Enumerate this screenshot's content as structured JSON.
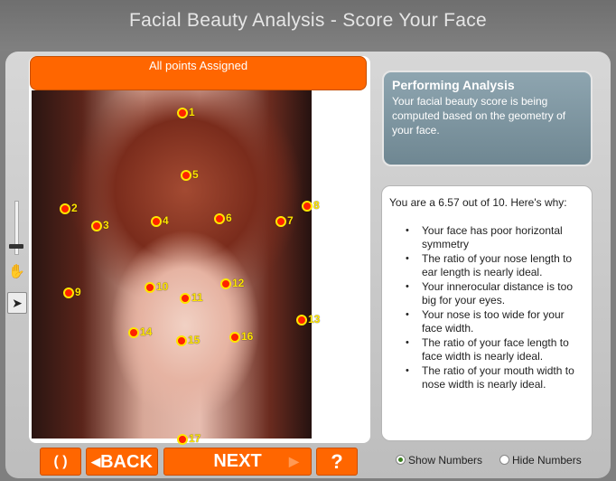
{
  "app": {
    "title": "Facial Beauty Analysis - Score Your Face"
  },
  "status": {
    "message": "All points Assigned"
  },
  "analysis": {
    "title": "Performing Analysis",
    "text": "Your facial beauty score is being computed based on the geometry of your face."
  },
  "results": {
    "summary": "You are a 6.57 out of 10.  Here's why:",
    "items": [
      "Your face has poor horizontal symmetry",
      "The ratio of your nose length to ear length is nearly ideal.",
      "Your innerocular distance is too big for your eyes.",
      "Your nose is too wide for your face width.",
      "The ratio of your face length to face width is nearly ideal.",
      "The ratio of your mouth width to nose width is nearly ideal."
    ]
  },
  "markers": [
    "1",
    "2",
    "3",
    "4",
    "5",
    "6",
    "7",
    "8",
    "9",
    "10",
    "11",
    "12",
    "13",
    "14",
    "15",
    "16",
    "17"
  ],
  "buttons": {
    "reset_symbol": "( )",
    "back_label": "BACK",
    "back_arrow": "◀",
    "next_label": "NEXT",
    "next_arrow": "▶",
    "help_label": "?"
  },
  "options": {
    "show_numbers": "Show Numbers",
    "hide_numbers": "Hide Numbers",
    "selected": "Show Numbers"
  },
  "icons": {
    "hand": "hand-icon",
    "cursor": "arrow-cursor-icon"
  },
  "colors": {
    "accent": "#ff6600",
    "marker_fill": "#ff2200",
    "marker_ring": "#ffe600",
    "panel_blue": "#7f96a0"
  }
}
